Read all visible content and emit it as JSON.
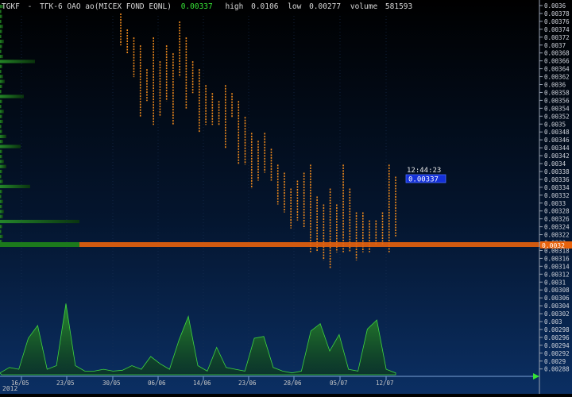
{
  "header": {
    "ticker": "TGKF",
    "name": "ТГК-6 ОАО ао(MICEX FOND EQNL)",
    "last": "0.00337",
    "high_label": "high",
    "high": "0.0106",
    "low_label": "low",
    "low": "0.00277",
    "volume_label": "volume",
    "volume": "581593"
  },
  "cursor": {
    "time": "12:44:23",
    "price": "0.00337"
  },
  "current_price": {
    "value": 0.0032,
    "label": "0.0032"
  },
  "colors": {
    "background_top": "#000000",
    "background_bottom": "#0b2f63",
    "tick": "#f08a1c",
    "volume_fill": "#1f6e1f",
    "volume_line": "#3fd43f",
    "current_price_line": "#e8620c",
    "cursor_price_box": "#1430d8",
    "header_last": "#36e436"
  },
  "chart_data": {
    "type": "scatter",
    "title": "ТГК-6 ОАО ао(MICEX FOND EQNL)",
    "xlabel": "",
    "ylabel": "",
    "ylim": [
      0.00288,
      0.0036
    ],
    "year_label": "2012",
    "x_ticks": [
      "16/05",
      "23/05",
      "30/05",
      "06/06",
      "14/06",
      "23/06",
      "28/06",
      "05/07",
      "12/07"
    ],
    "y_ticks": [
      0.0036,
      0.00378,
      0.00376,
      0.00374,
      0.00372,
      0.0037,
      0.00368,
      0.00366,
      0.00364,
      0.00362,
      0.0036,
      0.00358,
      0.00356,
      0.00354,
      0.00352,
      0.0035,
      0.00348,
      0.00346,
      0.00344,
      0.00342,
      0.0034,
      0.00338,
      0.00336,
      0.00334,
      0.00332,
      0.0033,
      0.00328,
      0.00326,
      0.00324,
      0.00322,
      0.0032,
      0.00318,
      0.00316,
      0.00314,
      0.00312,
      0.0031,
      0.00308,
      0.00306,
      0.00304,
      0.00302,
      0.003,
      0.00298,
      0.00296,
      0.00294,
      0.00292,
      0.0029,
      0.00288
    ],
    "y_tick_labels": [
      "0.0036",
      "0.00378",
      "0.00376",
      "0.00374",
      "0.00372",
      "0.0037",
      "0.00368",
      "0.00366",
      "0.00364",
      "0.00362",
      "0.0036",
      "0.00358",
      "0.00356",
      "0.00354",
      "0.00352",
      "0.0035",
      "0.00348",
      "0.00346",
      "0.00344",
      "0.00342",
      "0.0034",
      "0.00338",
      "0.00336",
      "0.00334",
      "0.00332",
      "0.0033",
      "0.00328",
      "0.00326",
      "0.00324",
      "0.00322",
      "0.0032",
      "0.00318",
      "0.00316",
      "0.00314",
      "0.00312",
      "0.0031",
      "0.00308",
      "0.00306",
      "0.00304",
      "0.00302",
      "0.003",
      "0.00298",
      "0.00296",
      "0.00294",
      "0.00292",
      "0.0029",
      "0.00288"
    ],
    "price_columns": [
      {
        "hi": 0.00378,
        "lo": 0.0037
      },
      {
        "hi": 0.00374,
        "lo": 0.00368
      },
      {
        "hi": 0.00372,
        "lo": 0.00362
      },
      {
        "hi": 0.0037,
        "lo": 0.00352
      },
      {
        "hi": 0.00364,
        "lo": 0.00356
      },
      {
        "hi": 0.00372,
        "lo": 0.0035
      },
      {
        "hi": 0.00366,
        "lo": 0.00352
      },
      {
        "hi": 0.0037,
        "lo": 0.00356
      },
      {
        "hi": 0.00368,
        "lo": 0.0035
      },
      {
        "hi": 0.00376,
        "lo": 0.00362
      },
      {
        "hi": 0.00372,
        "lo": 0.00354
      },
      {
        "hi": 0.00366,
        "lo": 0.00358
      },
      {
        "hi": 0.00364,
        "lo": 0.00348
      },
      {
        "hi": 0.0036,
        "lo": 0.0035
      },
      {
        "hi": 0.00358,
        "lo": 0.0035
      },
      {
        "hi": 0.00356,
        "lo": 0.0035
      },
      {
        "hi": 0.0036,
        "lo": 0.00344
      },
      {
        "hi": 0.00358,
        "lo": 0.00352
      },
      {
        "hi": 0.00356,
        "lo": 0.0034
      },
      {
        "hi": 0.00352,
        "lo": 0.0034
      },
      {
        "hi": 0.00348,
        "lo": 0.00334
      },
      {
        "hi": 0.00346,
        "lo": 0.00336
      },
      {
        "hi": 0.00348,
        "lo": 0.00338
      },
      {
        "hi": 0.00344,
        "lo": 0.00336
      },
      {
        "hi": 0.0034,
        "lo": 0.0033
      },
      {
        "hi": 0.00338,
        "lo": 0.00328
      },
      {
        "hi": 0.00334,
        "lo": 0.00324
      },
      {
        "hi": 0.00336,
        "lo": 0.00326
      },
      {
        "hi": 0.00338,
        "lo": 0.00324
      },
      {
        "hi": 0.0034,
        "lo": 0.00318
      },
      {
        "hi": 0.00332,
        "lo": 0.00318
      },
      {
        "hi": 0.0033,
        "lo": 0.00316
      },
      {
        "hi": 0.00334,
        "lo": 0.00314
      },
      {
        "hi": 0.0033,
        "lo": 0.00318
      },
      {
        "hi": 0.0034,
        "lo": 0.00318
      },
      {
        "hi": 0.00334,
        "lo": 0.00318
      },
      {
        "hi": 0.00328,
        "lo": 0.00316
      },
      {
        "hi": 0.00328,
        "lo": 0.00318
      },
      {
        "hi": 0.00326,
        "lo": 0.00318
      },
      {
        "hi": 0.00326,
        "lo": 0.0032
      },
      {
        "hi": 0.00328,
        "lo": 0.0032
      },
      {
        "hi": 0.0034,
        "lo": 0.00318
      },
      {
        "hi": 0.00337,
        "lo": 0.00322
      }
    ],
    "volume": [
      2,
      8,
      6,
      40,
      54,
      6,
      10,
      78,
      10,
      4,
      4,
      6,
      4,
      5,
      10,
      6,
      20,
      12,
      6,
      38,
      64,
      10,
      4,
      30,
      8,
      6,
      4,
      40,
      42,
      8,
      4,
      2,
      4,
      48,
      56,
      26,
      44,
      6,
      4,
      50,
      60,
      6,
      2
    ]
  }
}
